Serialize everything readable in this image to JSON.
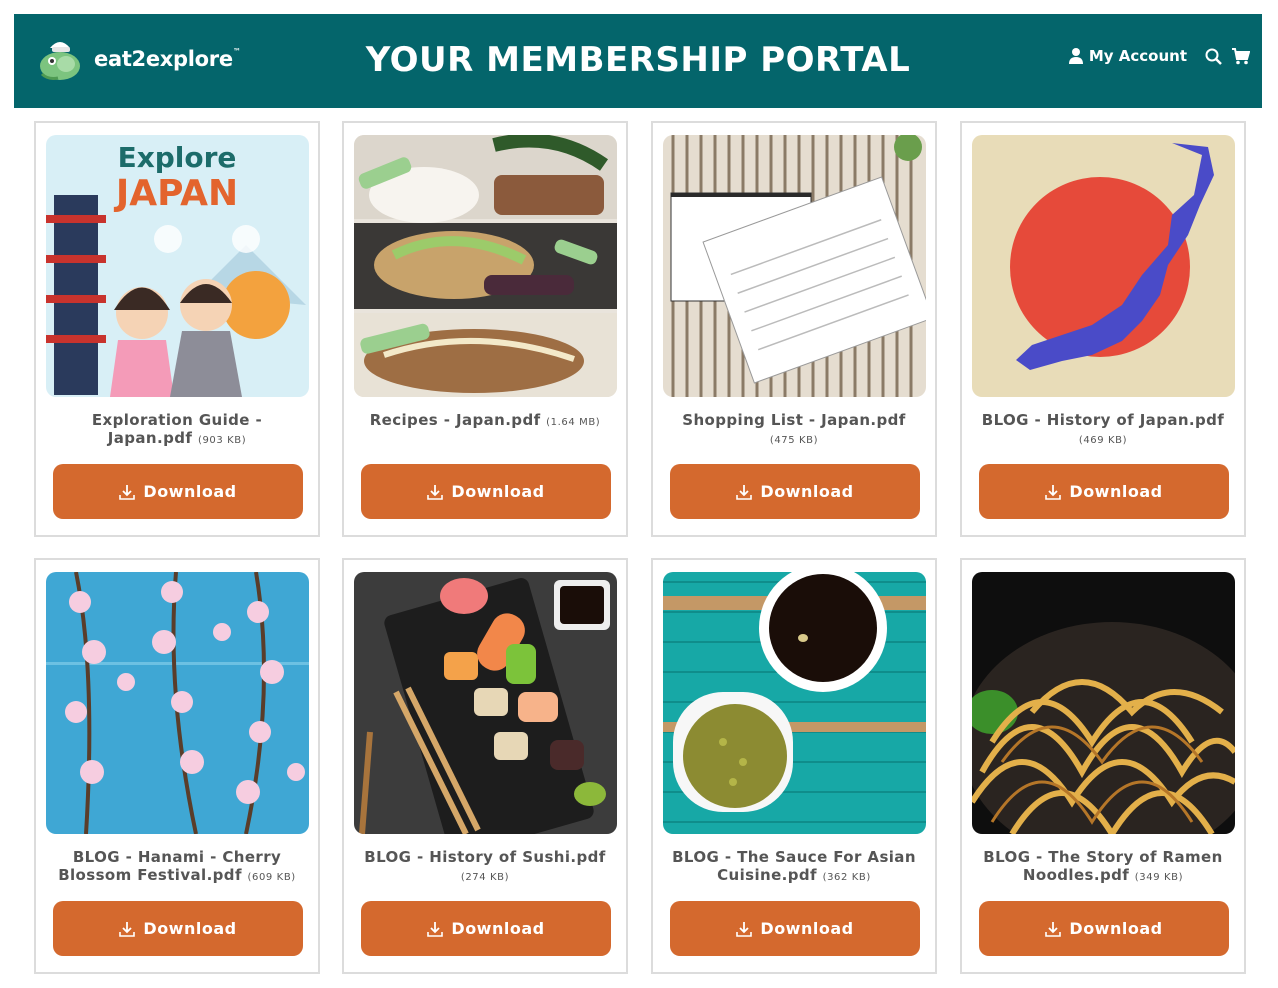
{
  "header": {
    "brand": "eat2explore",
    "trademark": "™",
    "title": "YOUR MEMBERSHIP PORTAL",
    "account_label": "My Account"
  },
  "colors": {
    "header_bg": "#04656b",
    "button_bg": "#d4692e",
    "text": "#555555"
  },
  "cards": [
    {
      "title": "Exploration Guide - Japan.pdf",
      "size": "(903 KB)",
      "button": "Download",
      "image": "explore-japan-cover"
    },
    {
      "title": "Recipes - Japan.pdf",
      "size": "(1.64 MB)",
      "button": "Download",
      "image": "japanese-dishes-collage"
    },
    {
      "title": "Shopping List - Japan.pdf",
      "size": "(475 KB)",
      "button": "Download",
      "image": "shopping-list-cards"
    },
    {
      "title": "BLOG - History of Japan.pdf",
      "size": "(469 KB)",
      "button": "Download",
      "image": "japan-map-flag"
    },
    {
      "title": "BLOG - Hanami - Cherry Blossom Festival.pdf",
      "size": "(609 KB)",
      "button": "Download",
      "image": "cherry-blossoms"
    },
    {
      "title": "BLOG - History of Sushi.pdf",
      "size": "(274 KB)",
      "button": "Download",
      "image": "sushi-board"
    },
    {
      "title": "BLOG - The Sauce For Asian Cuisine.pdf",
      "size": "(362 KB)",
      "button": "Download",
      "image": "soy-sauce-bowl"
    },
    {
      "title": "BLOG - The Story of Ramen Noodles.pdf",
      "size": "(349 KB)",
      "button": "Download",
      "image": "ramen-noodles"
    }
  ]
}
